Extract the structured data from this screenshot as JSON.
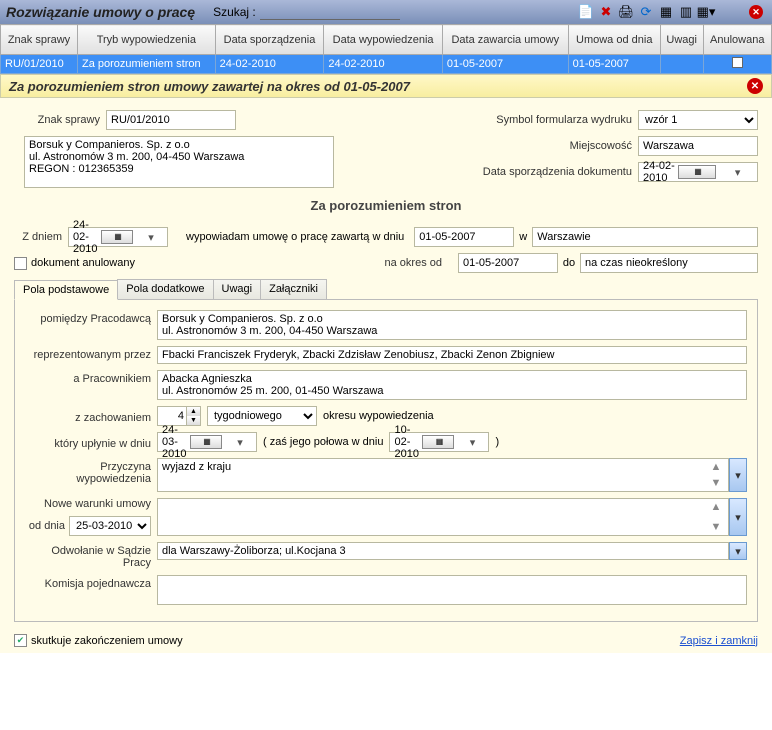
{
  "titlebar": {
    "title": "Rozwiązanie umowy o pracę",
    "search_label": "Szukaj :",
    "search_value": ""
  },
  "grid": {
    "headers": [
      "Znak sprawy",
      "Tryb wypowiedzenia",
      "Data sporządzenia",
      "Data wypowiedzenia",
      "Data zawarcia umowy",
      "Umowa od dnia",
      "Uwagi",
      "Anulowana"
    ],
    "row": [
      "RU/01/2010",
      "Za porozumieniem stron",
      "24-02-2010",
      "24-02-2010",
      "01-05-2007",
      "01-05-2007",
      "",
      ""
    ]
  },
  "subheader": "Za porozumieniem stron umowy zawartej na okres od 01-05-2007",
  "head": {
    "znak_lbl": "Znak sprawy",
    "znak": "RU/01/2010",
    "company": "Borsuk y Companieros. Sp. z o.o\nul. Astronomów 3 m. 200, 04-450 Warszawa\nREGON : 012365359",
    "symform_lbl": "Symbol formularza wydruku",
    "symform": "wzór 1",
    "miejsc_lbl": "Miejscowość",
    "miejsc": "Warszawa",
    "dspd_lbl": "Data sporządzenia dokumentu",
    "dspd": "24-02-2010"
  },
  "center_title": "Za porozumieniem stron",
  "line": {
    "zdniem_lbl": "Z dniem",
    "zdniem": "24-02-2010",
    "wyp_text": "wypowiadam umowę o pracę zawartą w dniu",
    "wyp_date": "01-05-2007",
    "w": "w",
    "w_val": "Warszawie",
    "anul_lbl": "dokument anulowany",
    "naokres_lbl": "na okres od",
    "naokres": "01-05-2007",
    "do": "do",
    "do_val": "na czas nieokreślony"
  },
  "tabs": [
    "Pola podstawowe",
    "Pola dodatkowe",
    "Uwagi",
    "Załączniki"
  ],
  "fields": {
    "pomiedzy_lbl": "pomiędzy Pracodawcą",
    "pomiedzy": "Borsuk y Companieros. Sp. z o.o\nul. Astronomów 3 m. 200, 04-450 Warszawa",
    "repre_lbl": "reprezentowanym przez",
    "repre": "Fbacki Franciszek Fryderyk, Zbacki Zdzisław Zenobiusz, Zbacki Zenon Zbigniew",
    "aprac_lbl": "a Pracownikiem",
    "aprac": "Abacka Agnieszka\nul. Astronomów 25 m. 200, 01-450 Warszawa",
    "zzach_lbl": "z zachowaniem",
    "zzach_n": "4",
    "zzach_unit": "tygodniowego",
    "zzach_after": "okresu wypowiedzenia",
    "ktory_lbl": "który upłynie w dniu",
    "ktory": "24-03-2010",
    "zas": "( zaś jego połowa w dniu",
    "zas_date": "10-02-2010",
    "zas_close": ")",
    "przy_lbl": "Przyczyna wypowiedzenia",
    "przy": "wyjazd z kraju",
    "nowe_lbl": "Nowe warunki umowy",
    "oddnia_lbl": "od dnia",
    "oddnia": "25-03-2010",
    "nowe": "",
    "odw_lbl": "Odwołanie w Sądzie Pracy",
    "odw": "dla Warszawy-Żoliborza; ul.Kocjana 3",
    "kom_lbl": "Komisja pojednawcza",
    "kom": ""
  },
  "footer": {
    "skutk": "skutkuje zakończeniem umowy",
    "save": "Zapisz i zamknij"
  }
}
